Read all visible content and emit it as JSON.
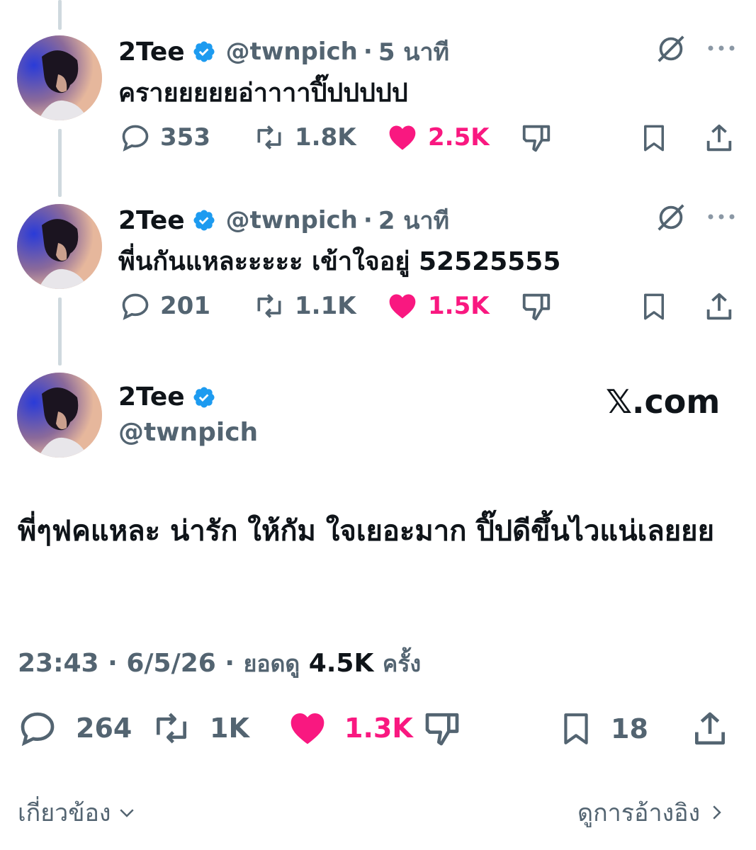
{
  "tweets": [
    {
      "name": "2Tee",
      "handle": "@twnpich",
      "time": "5 นาที",
      "text": "ครายยยยยอ่าาาาปิ๊ปปปปป",
      "replies": "353",
      "retweets": "1.8K",
      "likes": "2.5K"
    },
    {
      "name": "2Tee",
      "handle": "@twnpich",
      "time": "2 นาที",
      "text": "พี่นกันแหละะะะะ เข้าใจอยู่ 52525555",
      "replies": "201",
      "retweets": "1.1K",
      "likes": "1.5K"
    }
  ],
  "main": {
    "name": "2Tee",
    "handle": "@twnpich",
    "brand": "𝕏.com",
    "text": "พี่ๆฟคแหละ น่ารัก ให้กัม ใจเยอะมาก ปิ๊ปดีขึ้นไวแน่เลยยย",
    "time": "23:43",
    "date": "6/5/26",
    "views_label": "ยอดดู",
    "views": "4.5K",
    "views_suffix": "ครั้ง",
    "replies": "264",
    "retweets": "1K",
    "likes": "1.3K",
    "bookmarks": "18"
  },
  "footer": {
    "related": "เกี่ยวข้อง",
    "quotes": "ดูการอ้างอิง"
  },
  "colors": {
    "like": "#f91880",
    "muted": "#536471",
    "verified": "#1d9bf0",
    "thread_line": "#cfd9de"
  }
}
